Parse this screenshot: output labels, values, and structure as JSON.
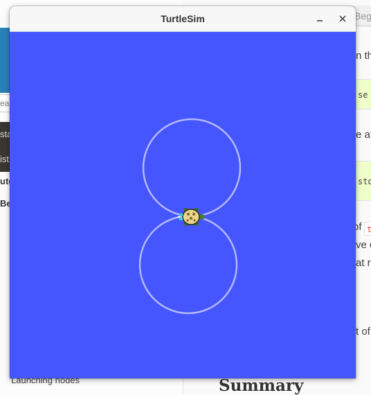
{
  "window": {
    "title": "TurtleSim",
    "background_color": "#4556ff",
    "pen_color": "#b3b8ff",
    "minimize_icon": "minimize-icon",
    "close_icon": "close-icon"
  },
  "turtle": {
    "icon": "turtle-icon"
  },
  "background_page": {
    "tab_partial": "Beg",
    "search_partial": "ear",
    "nav_dark_items": [
      "sta",
      "ist"
    ],
    "nav_bold_item": "uto",
    "nav_sub_item": "Be",
    "nav_bottom_item": "Launching nodes",
    "heading": "Summary",
    "right_fragments": [
      {
        "kind": "text",
        "text": "n th"
      },
      {
        "kind": "code",
        "text": "se"
      },
      {
        "kind": "text",
        "text": "e at"
      },
      {
        "kind": "code",
        "text": "std"
      },
      {
        "kind": "text",
        "text": "of"
      },
      {
        "kind": "inline_code",
        "text": "t"
      },
      {
        "kind": "text",
        "text": "ve c"
      },
      {
        "kind": "text",
        "text": "at ra"
      },
      {
        "kind": "text",
        "text": "t of"
      }
    ]
  }
}
